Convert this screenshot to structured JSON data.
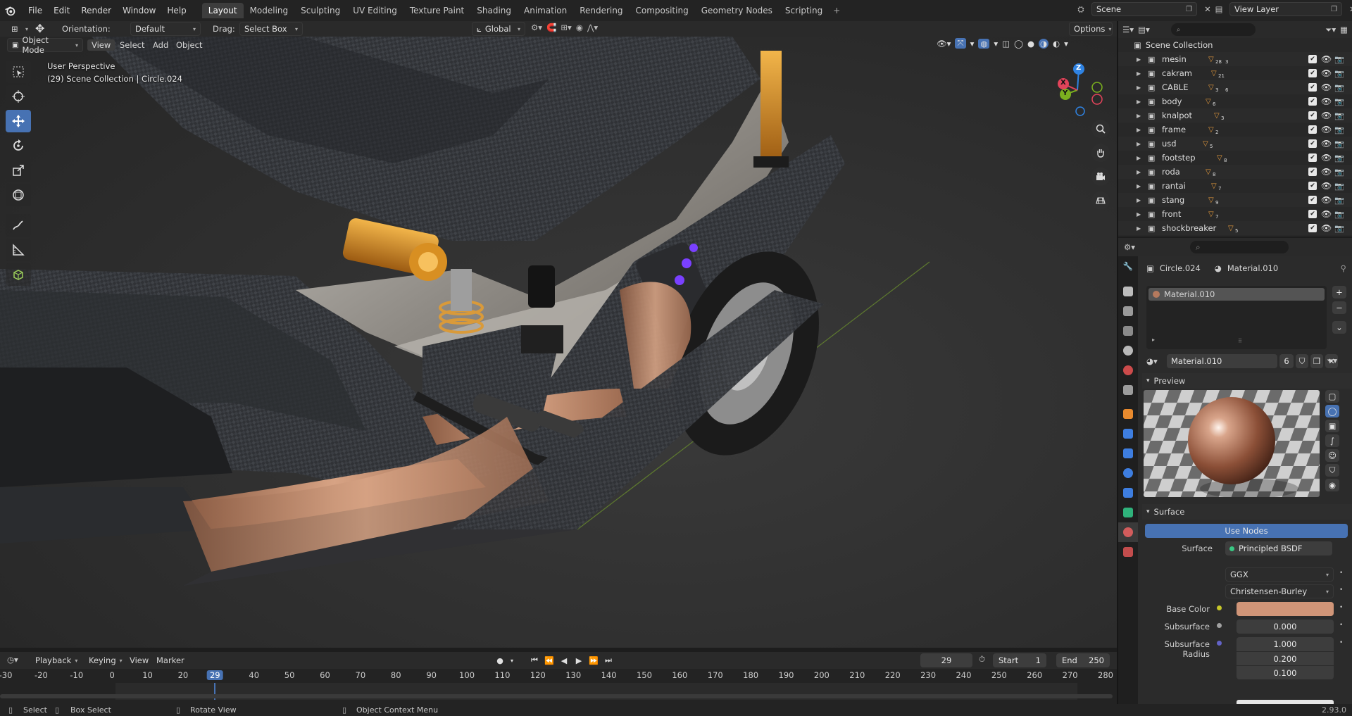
{
  "topbar": {
    "menus": [
      "File",
      "Edit",
      "Render",
      "Window",
      "Help"
    ],
    "workspace_tabs": [
      "Layout",
      "Modeling",
      "Sculpting",
      "UV Editing",
      "Texture Paint",
      "Shading",
      "Animation",
      "Rendering",
      "Compositing",
      "Geometry Nodes",
      "Scripting"
    ],
    "active_tab": "Layout",
    "scene_name": "Scene",
    "view_layer": "View Layer"
  },
  "tool_header": {
    "orientation_label": "Orientation:",
    "orientation_value": "Default",
    "drag_label": "Drag:",
    "drag_value": "Select Box",
    "transform_orientation": "Global",
    "options_label": "Options"
  },
  "viewport_header": {
    "mode": "Object Mode",
    "menus": [
      "View",
      "Select",
      "Add",
      "Object"
    ]
  },
  "viewport": {
    "perspective": "User Perspective",
    "collection_info": "(29) Scene Collection | Circle.024",
    "gizmo_axes": {
      "z": "Z",
      "y": "Y",
      "x": "X"
    },
    "axis_colors": {
      "x": "#e2435a",
      "y": "#7bb01f",
      "z": "#2f83e3"
    }
  },
  "outliner": {
    "root": "Scene Collection",
    "items": [
      {
        "name": "mesin",
        "badge": "28",
        "badge2": "3"
      },
      {
        "name": "cakram",
        "badge": "21",
        "badge2": ""
      },
      {
        "name": "CABLE",
        "badge": "3",
        "badge2": "6"
      },
      {
        "name": "body",
        "badge": "6",
        "badge2": ""
      },
      {
        "name": "knalpot",
        "badge": "3",
        "badge2": ""
      },
      {
        "name": "frame",
        "badge": "2",
        "badge2": ""
      },
      {
        "name": "usd",
        "badge": "5",
        "badge2": ""
      },
      {
        "name": "footstep",
        "badge": "8",
        "badge2": ""
      },
      {
        "name": "roda",
        "badge": "8",
        "badge2": ""
      },
      {
        "name": "rantai",
        "badge": "7",
        "badge2": ""
      },
      {
        "name": "stang",
        "badge": "9",
        "badge2": ""
      },
      {
        "name": "front",
        "badge": "7",
        "badge2": ""
      },
      {
        "name": "shockbreaker",
        "badge": "5",
        "badge2": ""
      }
    ]
  },
  "properties": {
    "object_name": "Circle.024",
    "material_name": "Material.010",
    "slot_name": "Material.010",
    "material_field": "Material.010",
    "user_count": "6",
    "preview_label": "Preview",
    "surface_panel": "Surface",
    "use_nodes": "Use Nodes",
    "surface_label": "Surface",
    "surface_value": "Principled BSDF",
    "distribution": "GGX",
    "subsurface_method": "Christensen-Burley",
    "base_color_label": "Base Color",
    "base_color": "#d09578",
    "subsurface_label": "Subsurface",
    "subsurface_value": "0.000",
    "subsurface_radius_label": "Subsurface Radius",
    "subsurface_radius": [
      "1.000",
      "0.200",
      "0.100"
    ]
  },
  "timeline": {
    "menus": [
      "Playback",
      "Keying",
      "View",
      "Marker"
    ],
    "current_frame": "29",
    "start_label": "Start",
    "start": "1",
    "end_label": "End",
    "end": "250",
    "ticks": [
      "-30",
      "-20",
      "-10",
      "0",
      "10",
      "20",
      "29",
      "40",
      "50",
      "60",
      "70",
      "80",
      "90",
      "100",
      "110",
      "120",
      "130",
      "140",
      "150",
      "160",
      "170",
      "180",
      "190",
      "200",
      "210",
      "220",
      "230",
      "240",
      "250",
      "260",
      "270",
      "280"
    ]
  },
  "statusbar": {
    "select": "Select",
    "box_select": "Box Select",
    "rotate_view": "Rotate View",
    "context_menu": "Object Context Menu",
    "version": "2.93.0"
  }
}
